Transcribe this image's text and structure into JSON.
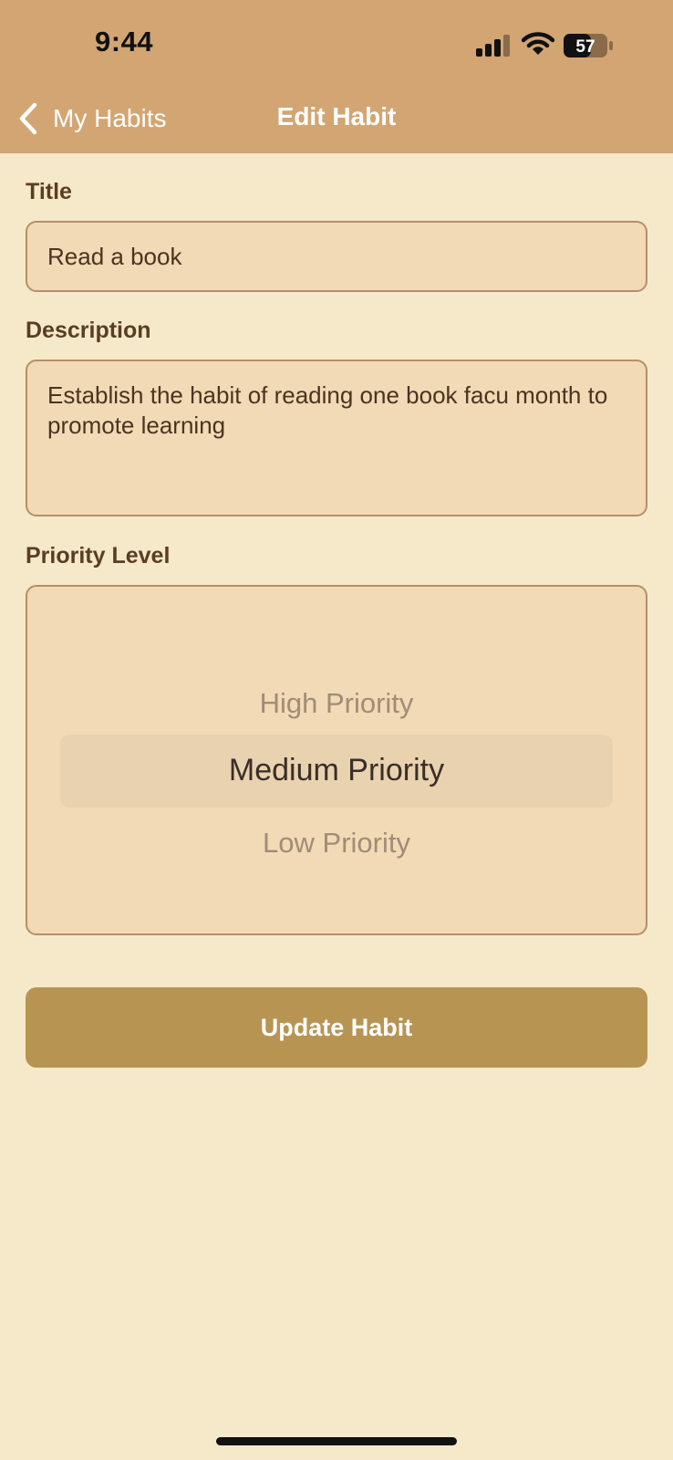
{
  "status_bar": {
    "time": "9:44",
    "battery_level": "57",
    "icons": [
      "cellular-signal-icon",
      "wifi-icon",
      "battery-icon"
    ]
  },
  "nav": {
    "back_label": "My Habits",
    "title": "Edit Habit",
    "back_icon": "chevron-left-icon"
  },
  "form": {
    "title_label": "Title",
    "title_value": "Read a book",
    "description_label": "Description",
    "description_value": "Establish the habit of reading one book facu month to promote learning",
    "priority_label": "Priority Level",
    "priority_options": [
      "High Priority",
      "Medium Priority",
      "Low Priority"
    ],
    "priority_selected": "Medium Priority"
  },
  "actions": {
    "update_label": "Update Habit"
  },
  "colors": {
    "header": "#D2A572",
    "background": "#F6E9C9",
    "field_bg": "#F2DAB6",
    "field_border": "#B58F6A",
    "button": "#B89453",
    "label_text": "#5A3E22"
  }
}
